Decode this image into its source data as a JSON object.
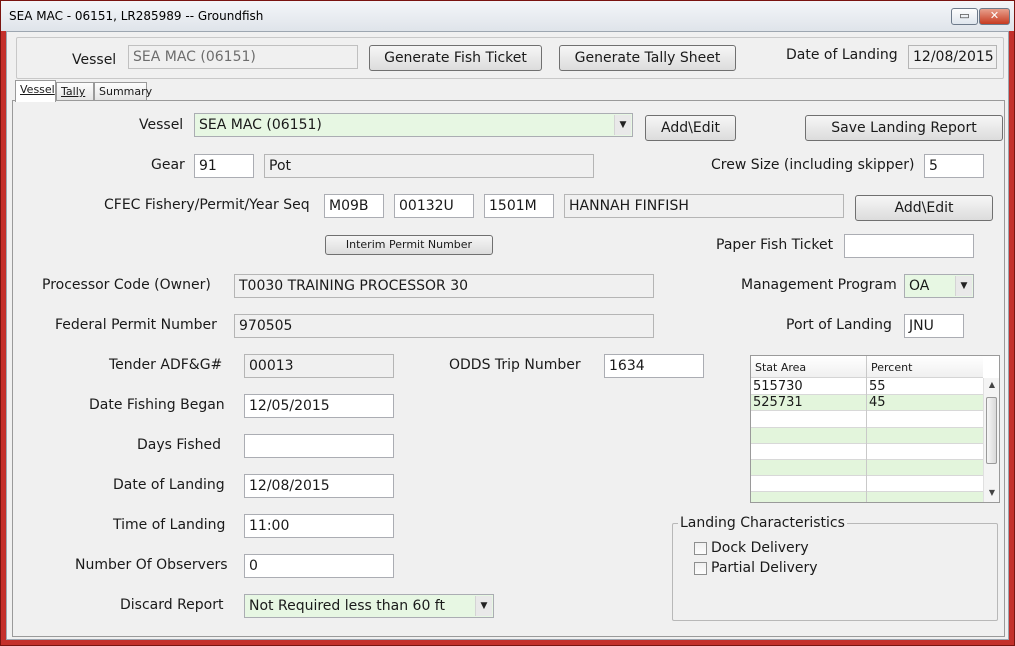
{
  "window": {
    "title": "SEA MAC - 06151, LR285989 -- Groundfish",
    "minimize": "▭",
    "close": "✕"
  },
  "header": {
    "vessel_label": "Vessel",
    "vessel_value": "SEA MAC (06151)",
    "generate_fish_ticket": "Generate Fish Ticket",
    "generate_tally_sheet": "Generate Tally Sheet",
    "date_of_landing_label": "Date of Landing",
    "date_of_landing_value": "12/08/2015"
  },
  "tabs": [
    {
      "label": "Vessel",
      "active": true
    },
    {
      "label": "Tally",
      "active": false
    },
    {
      "label": "Summary",
      "active": false
    }
  ],
  "form": {
    "vessel_label": "Vessel",
    "vessel_value": "SEA MAC (06151)",
    "add_edit_1": "Add\\Edit",
    "save_landing_report": "Save Landing Report",
    "gear_label": "Gear",
    "gear_code": "91",
    "gear_name": "Pot",
    "crew_size_label": "Crew Size (including skipper)",
    "crew_size_value": "5",
    "cfec_label": "CFEC Fishery/Permit/Year Seq",
    "cfec_fishery": "M09B",
    "cfec_permit": "00132U",
    "cfec_year_seq": "1501M",
    "cfec_holder": "HANNAH FINFISH",
    "add_edit_2": "Add\\Edit",
    "interim_permit_button": "Interim Permit Number",
    "paper_fish_ticket_label": "Paper Fish Ticket",
    "paper_fish_ticket_value": "",
    "processor_code_label": "Processor Code (Owner)",
    "processor_code_value": "T0030 TRAINING PROCESSOR 30",
    "management_program_label": "Management Program",
    "management_program_value": "OA",
    "federal_permit_label": "Federal Permit Number",
    "federal_permit_value": "970505",
    "port_of_landing_label": "Port of Landing",
    "port_of_landing_value": "JNU",
    "tender_label": "Tender ADF&G#",
    "tender_value": "00013",
    "odds_label": "ODDS Trip Number",
    "odds_value": "1634",
    "date_fishing_began_label": "Date Fishing Began",
    "date_fishing_began_value": "12/05/2015",
    "days_fished_label": "Days Fished",
    "days_fished_value": "",
    "date_of_landing_label": "Date of Landing",
    "date_of_landing_value": "12/08/2015",
    "time_of_landing_label": "Time of Landing",
    "time_of_landing_value": "11:00",
    "observers_label": "Number Of Observers",
    "observers_value": "0",
    "discard_report_label": "Discard Report",
    "discard_report_value": "Not Required less than 60 ft"
  },
  "stat_grid": {
    "columns": [
      "Stat Area",
      "Percent"
    ],
    "rows": [
      {
        "stat_area": "515730",
        "percent": "55"
      },
      {
        "stat_area": "525731",
        "percent": "45"
      }
    ]
  },
  "landing_characteristics": {
    "legend": "Landing Characteristics",
    "dock_delivery": "Dock Delivery",
    "partial_delivery": "Partial Delivery"
  }
}
